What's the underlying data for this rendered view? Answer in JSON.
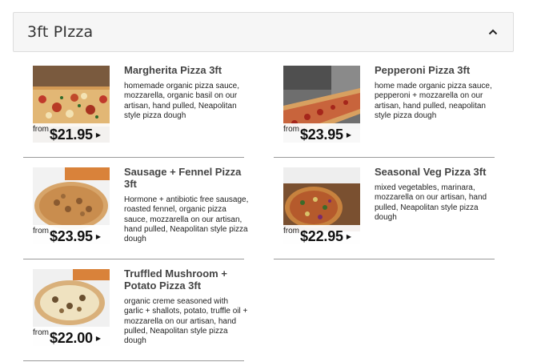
{
  "section": {
    "title": "3ft PIzza"
  },
  "items": [
    {
      "name": "Margherita Pizza 3ft",
      "description": "homemade organic pizza sauce, mozzarella, organic basil on our artisan, hand pulled, Neapolitan style pizza dough",
      "from": "from",
      "price": "$21.95",
      "image_icon": "margherita-pizza-photo"
    },
    {
      "name": "Pepperoni Pizza 3ft",
      "description": "home made organic pizza sauce, pepperoni + mozzarella on our artisan, hand pulled, neapolitan style pizza dough",
      "from": "from",
      "price": "$23.95",
      "image_icon": "pepperoni-pizza-photo"
    },
    {
      "name": "Sausage + Fennel Pizza 3ft",
      "description": "Hormone + antibiotic free sausage, roasted fennel, organic pizza sauce, mozzarella on our artisan, hand pulled, Neapolitan style pizza dough",
      "from": "from",
      "price": "$23.95",
      "image_icon": "sausage-fennel-pizza-photo"
    },
    {
      "name": "Seasonal Veg Pizza 3ft",
      "description": "mixed vegetables, marinara, mozzarella on our artisan, hand pulled, Neapolitan style pizza dough",
      "from": "from",
      "price": "$22.95",
      "image_icon": "seasonal-veg-pizza-photo"
    },
    {
      "name": "Truffled Mushroom + Potato Pizza 3ft",
      "description": "organic creme seasoned with garlic + shallots, potato, truffle oil + mozzarella on our artisan, hand pulled, Neapolitan style pizza dough",
      "from": "from",
      "price": "$22.00",
      "image_icon": "truffled-mushroom-pizza-photo"
    }
  ],
  "colors": {
    "header_bg": "#f6f6f6",
    "divider": "#9a9a9a",
    "text": "#333333"
  }
}
